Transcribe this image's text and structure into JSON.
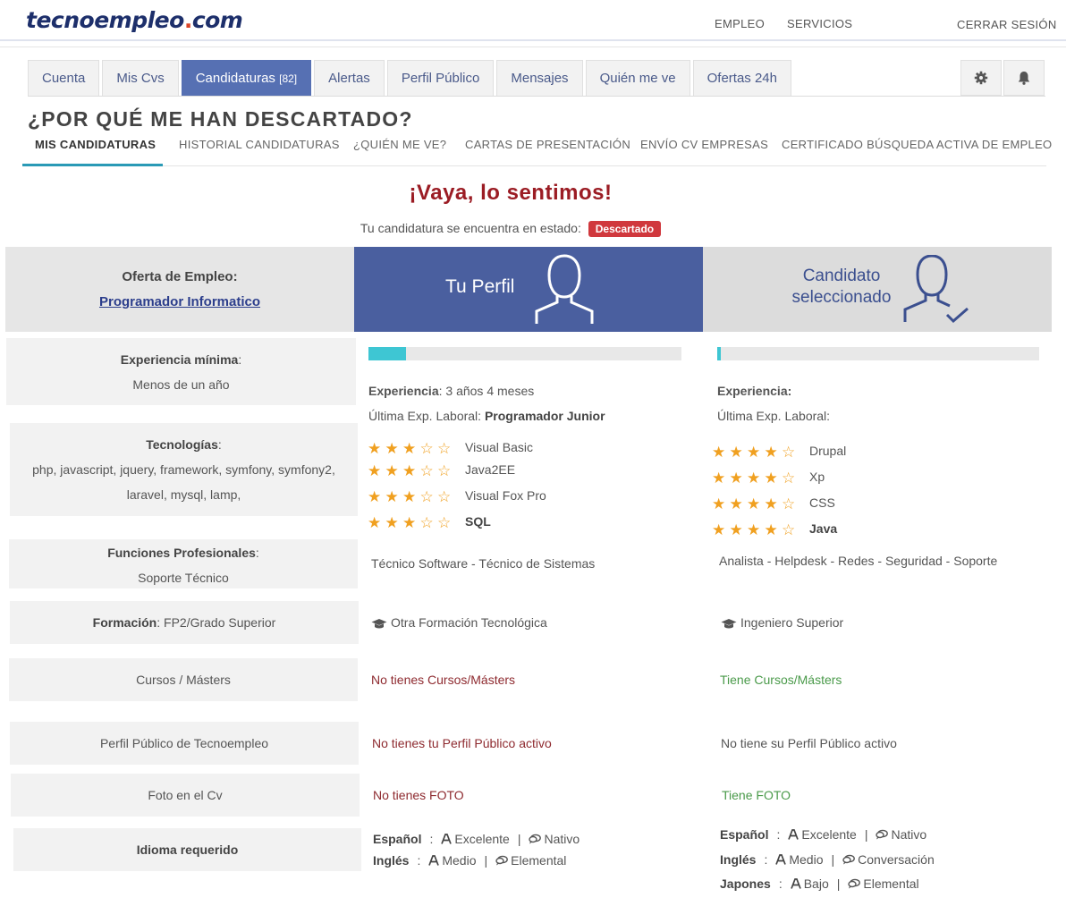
{
  "brand": {
    "logo_main": "tecnoempleo",
    "logo_dot": ".",
    "logo_tld": "com"
  },
  "top_nav": {
    "empleo": "EMPLEO",
    "servicios": "SERVICIOS",
    "logout": "CERRAR SESIÓN"
  },
  "tabs": [
    {
      "label": "Cuenta"
    },
    {
      "label": "Mis Cvs"
    },
    {
      "label": "Candidaturas",
      "count": "[82]"
    },
    {
      "label": "Alertas"
    },
    {
      "label": "Perfil Público"
    },
    {
      "label": "Mensajes"
    },
    {
      "label": "Quién me ve"
    },
    {
      "label": "Ofertas 24h"
    }
  ],
  "page_title": "¿POR QUÉ ME HAN DESCARTADO?",
  "subnav": [
    "MIS CANDIDATURAS",
    "HISTORIAL CANDIDATURAS",
    "¿QUIÉN ME VE?",
    "CARTAS DE PRESENTACIÓN",
    "ENVÍO CV EMPRESAS",
    "CERTIFICADO BÚSQUEDA ACTIVA DE EMPLEO"
  ],
  "sorry": "¡Vaya, lo sentimos!",
  "status_text": "Tu candidatura se encuentra en estado:",
  "status_badge": "Descartado",
  "header_row": {
    "offer_label": "Oferta de Empleo:",
    "offer_link": "Programador Informatico",
    "profile": "Tu Perfil",
    "candidate_line1": "Candidato",
    "candidate_line2": "seleccionado"
  },
  "labels": {
    "experience_title": "Experiencia mínima",
    "experience_value": "Menos de un año",
    "tech_title": "Tecnologías",
    "tech_line1": "php, javascript, jquery, framework, symfony, symfony2,",
    "tech_line2": "laravel, mysql, lamp,",
    "functions_title": "Funciones Profesionales",
    "functions_value": "Soporte Técnico",
    "education_title": "Formación",
    "education_value": "FP2/Grado Superior",
    "courses": "Cursos / Másters",
    "public_profile": "Perfil Público de Tecnoempleo",
    "photo": "Foto en el Cv",
    "languages": "Idioma requerido",
    "colon": ":"
  },
  "you": {
    "match": 0.12,
    "exp_label": "Experiencia",
    "exp_value": "3 años 4 meses",
    "last_exp_label": "Última Exp. Laboral:",
    "last_exp_value": "Programador Junior",
    "skills": [
      {
        "name": "Visual Basic",
        "stars": 3
      },
      {
        "name": "Java2EE",
        "stars": 3
      },
      {
        "name": "Visual Fox Pro",
        "stars": 3
      },
      {
        "name": "SQL",
        "stars": 3
      }
    ],
    "functions": "Técnico Software - Técnico de Sistemas",
    "education": "Otra Formación Tecnológica",
    "courses": "No tienes Cursos/Másters",
    "public_profile": "No tienes tu Perfil Público activo",
    "photo": "No tienes FOTO",
    "languages": [
      {
        "name": "Español",
        "written": "Excelente",
        "spoken": "Nativo"
      },
      {
        "name": "Inglés",
        "written": "Medio",
        "spoken": "Elemental"
      }
    ]
  },
  "candidate": {
    "match": 0.01,
    "exp_label": "Experiencia:",
    "last_exp_label": "Última Exp. Laboral:",
    "skills": [
      {
        "name": "Drupal",
        "stars": 4
      },
      {
        "name": "Xp",
        "stars": 4
      },
      {
        "name": "CSS",
        "stars": 4
      },
      {
        "name": "Java",
        "stars": 4
      }
    ],
    "functions": "Analista - Helpdesk - Redes - Seguridad - Soporte",
    "education": "Ingeniero Superior",
    "courses": "Tiene Cursos/Másters",
    "public_profile": "No tiene su Perfil Público activo",
    "photo": "Tiene FOTO",
    "languages": [
      {
        "name": "Español",
        "written": "Excelente",
        "spoken": "Nativo"
      },
      {
        "name": "Inglés",
        "written": "Medio",
        "spoken": "Conversación"
      },
      {
        "name": "Japones",
        "written": "Bajo",
        "spoken": "Elemental"
      }
    ]
  },
  "icons": {
    "settings": "gear-icon",
    "notifications": "bell-icon",
    "education": "graduation-cap-icon",
    "written": "letter-a-icon",
    "spoken": "speech-bubble-icon",
    "profile": "user-icon",
    "candidate": "user-check-icon"
  },
  "colors": {
    "brand_navy": "#1d2f6b",
    "active_tab": "#5670b3",
    "profile_header": "#4a5f9f",
    "sorry_red": "#9b1c24",
    "badge_red": "#d0383d",
    "star": "#f0a020",
    "progress": "#3ec6d3",
    "positive": "#4a9a4a",
    "negative": "#8e2a2f"
  }
}
